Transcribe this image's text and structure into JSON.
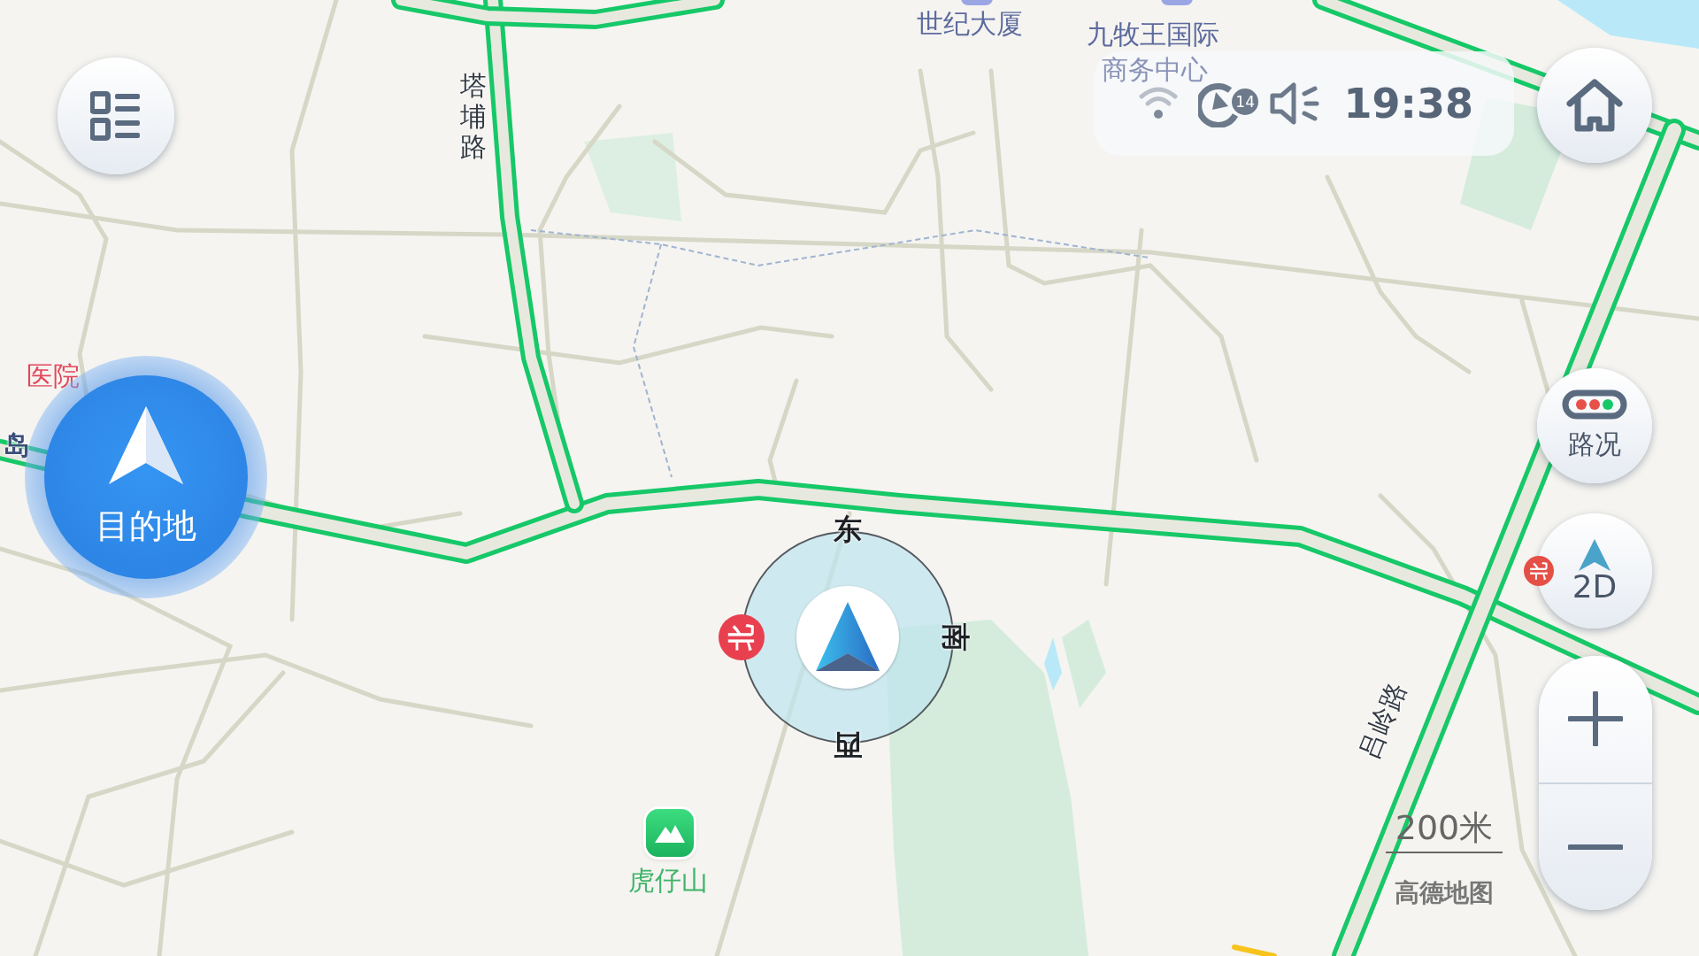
{
  "map_labels": [
    {
      "text": "世纪大厦",
      "kind": "building"
    },
    {
      "text": "九牧王国际",
      "kind": "building"
    },
    {
      "text": "商务中心",
      "kind": "faded"
    },
    {
      "text": "塔埔路",
      "kind": "road_vertical"
    },
    {
      "text": "医院",
      "kind": "hospital"
    },
    {
      "text": "岛",
      "kind": "road"
    },
    {
      "text": "虎仔山",
      "kind": "park"
    },
    {
      "text": "吕岭路",
      "kind": "road_rotated"
    }
  ],
  "status_bar": {
    "satellite_count": "14",
    "time": "19:38"
  },
  "destination_button": {
    "label": "目的地"
  },
  "compass": {
    "east": "东",
    "south": "南",
    "west": "西",
    "north": "北"
  },
  "traffic_button": {
    "label": "路况",
    "on": true
  },
  "view_button": {
    "label": "2D",
    "north_badge": "北"
  },
  "scale": {
    "label": "200米"
  },
  "logo": "高德地图"
}
